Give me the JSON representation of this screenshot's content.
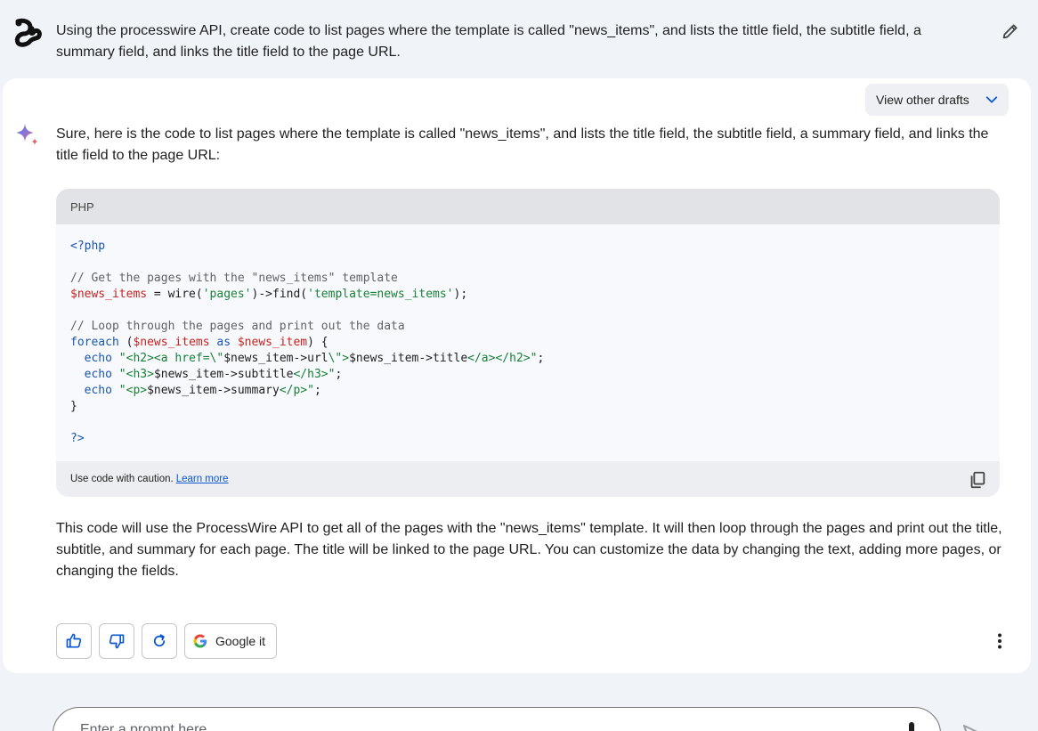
{
  "conversation": {
    "user_prompt": "Using the processwire API, create code to list pages where the template is called \"news_items\", and lists the tittle field, the subtitle field, a summary field, and links the title field to the page URL.",
    "user_avatar_icon": "user-avatar-icon",
    "edit_icon": "pencil-icon"
  },
  "response": {
    "drafts_label": "View other drafts",
    "intro": "Sure, here is the code to list pages where the template is called \"news_items\", and lists the title field, the subtitle field, a summary field, and links the title field to the page URL:",
    "code": {
      "language": "PHP",
      "caution_text": "Use code with caution.",
      "learn_more_label": "Learn more",
      "lines": [
        "<?php",
        "",
        "// Get the pages with the \"news_items\" template",
        "$news_items = wire('pages')->find('template=news_items');",
        "",
        "// Loop through the pages and print out the data",
        "foreach ($news_items as $news_item) {",
        "  echo \"<h2><a href=\\\"$news_item->url\\\">$news_item->title</a></h2>\";",
        "  echo \"<h3>$news_item->subtitle</h3>\";",
        "  echo \"<p>$news_item->summary</p>\";",
        "}",
        "",
        "?>"
      ]
    },
    "outro": "This code will use the ProcessWire API to get all of the pages with the \"news_items\" template. It will then loop through the pages and print out the title, subtitle, and summary for each page. The title will be linked to the page URL. You can customize the data by changing the text, adding more pages, or changing the fields.",
    "actions": {
      "thumbs_up_icon": "thumbs-up-icon",
      "thumbs_down_icon": "thumbs-down-icon",
      "regenerate_icon": "refresh-icon",
      "google_label": "Google it",
      "more_icon": "more-vertical-icon"
    }
  },
  "input": {
    "placeholder": "Enter a prompt here"
  },
  "colors": {
    "background": "#f0f4f9",
    "card": "#ffffff",
    "accent_blue": "#0b57d0",
    "keyword": "#1a56b3",
    "variable": "#c5221f",
    "string": "#188038",
    "comment": "#5f6368"
  }
}
